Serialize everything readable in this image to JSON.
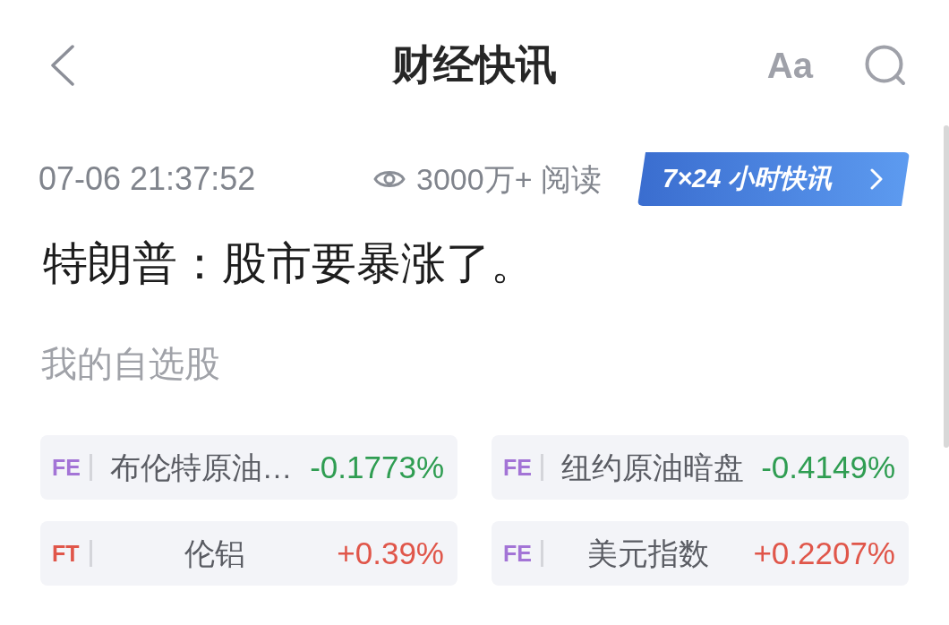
{
  "header": {
    "title": "财经快讯",
    "font_button": "Aa"
  },
  "article": {
    "time": "07-06 21:37:52",
    "views": "3000万+ 阅读",
    "live_button": "7×24 小时快讯",
    "headline": "特朗普：股市要暴涨了。"
  },
  "watchlist": {
    "title": "我的自选股",
    "items": [
      {
        "tag": {
          "text": "FE",
          "color": "#a374d6"
        },
        "name": "布伦特原油…",
        "change": {
          "text": "-0.1773%",
          "color": "#2f9d52"
        }
      },
      {
        "tag": {
          "text": "FE",
          "color": "#a374d6"
        },
        "name": "纽约原油暗盘",
        "change": {
          "text": "-0.4149%",
          "color": "#2f9d52"
        }
      },
      {
        "tag": {
          "text": "FT",
          "color": "#e0564a"
        },
        "name": "伦铝",
        "change": {
          "text": "+0.39%",
          "color": "#e0564a"
        }
      },
      {
        "tag": {
          "text": "FE",
          "color": "#a374d6"
        },
        "name": "美元指数",
        "change": {
          "text": "+0.2207%",
          "color": "#e0564a"
        }
      }
    ]
  }
}
